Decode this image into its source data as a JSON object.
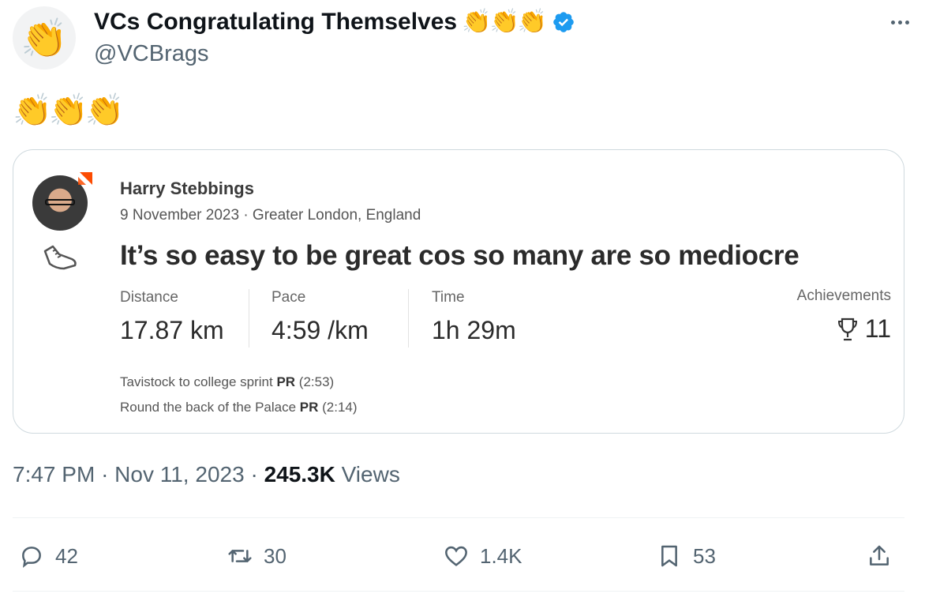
{
  "author": {
    "display_name": "VCs Congratulating Themselves",
    "name_emojis": "👏👏👏",
    "handle": "@VCBrags",
    "avatar_emoji": "👏",
    "verified": true,
    "verified_color": "#1d9bf0"
  },
  "tweet": {
    "text": "👏👏👏"
  },
  "card": {
    "athlete_name": "Harry Stebbings",
    "meta": "9 November 2023 · Greater London, England",
    "activity_title": "It’s so easy to be great cos so many are so mediocre",
    "stats": [
      {
        "label": "Distance",
        "value": "17.87 km"
      },
      {
        "label": "Pace",
        "value": "4:59 /km"
      },
      {
        "label": "Time",
        "value": "1h 29m"
      }
    ],
    "achievements": {
      "label": "Achievements",
      "value": "11",
      "icon": "trophy-icon"
    },
    "segments": [
      {
        "name": "Tavistock to college sprint",
        "badge": "PR",
        "time": "(2:53)"
      },
      {
        "name": "Round the back of the Palace",
        "badge": "PR",
        "time": "(2:14)"
      }
    ],
    "brand_color": "#fc4c02"
  },
  "footer": {
    "time": "7:47 PM",
    "date": "Nov 11, 2023",
    "views_count": "245.3K",
    "views_label": "Views"
  },
  "actions": {
    "replies": "42",
    "retweets": "30",
    "likes": "1.4K",
    "bookmarks": "53"
  }
}
